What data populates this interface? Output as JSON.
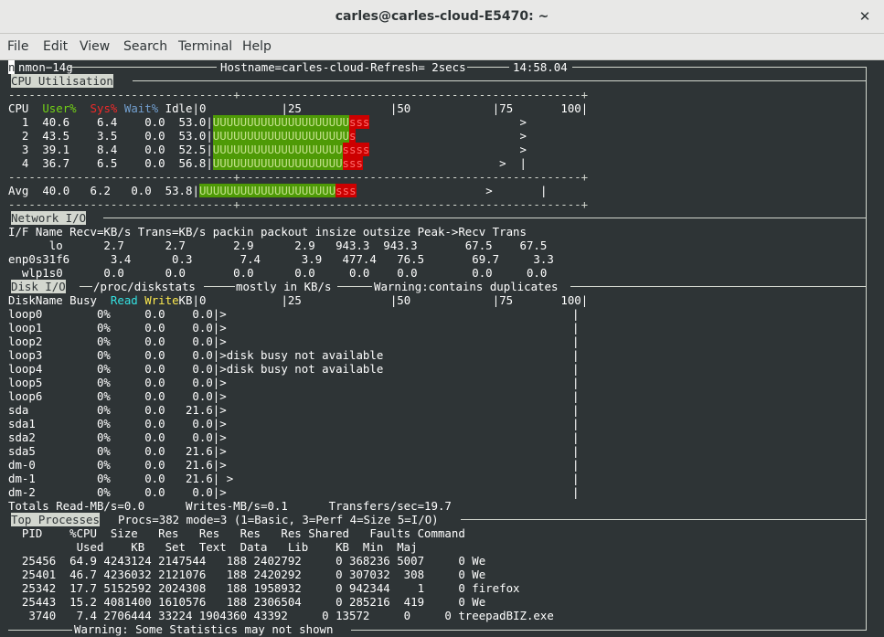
{
  "window": {
    "title": "carles@carles-cloud-E5470: ~"
  },
  "menu": [
    "File",
    "Edit",
    "View",
    "Search",
    "Terminal",
    "Help"
  ],
  "nmon": {
    "header_left": "nmon−14g",
    "header_center": "Hostname=carles-cloud-Refresh= 2secs",
    "header_time": "14:58.04",
    "cpu": {
      "title": "CPU Utilisation",
      "col_cpu": "CPU",
      "col_user": "User%",
      "col_sys": "Sys%",
      "col_wait": "Wait%",
      "col_idle": "Idle",
      "scale": [
        "0",
        "|25",
        "|50",
        "|75",
        "100"
      ],
      "rows": [
        {
          "id": "1",
          "user": "40.6",
          "sys": "6.4",
          "wait": "0.0",
          "idle": "53.0",
          "u_bar": "UUUUUUUUUUUUUUUUUUUU",
          "s_bar": "sss",
          "marker": ">"
        },
        {
          "id": "2",
          "user": "43.5",
          "sys": "3.5",
          "wait": "0.0",
          "idle": "53.0",
          "u_bar": "UUUUUUUUUUUUUUUUUUUU",
          "s_bar": "s",
          "marker": ">"
        },
        {
          "id": "3",
          "user": "39.1",
          "sys": "8.4",
          "wait": "0.0",
          "idle": "52.5",
          "u_bar": "UUUUUUUUUUUUUUUUUUU",
          "s_bar": "ssss",
          "marker": ">"
        },
        {
          "id": "4",
          "user": "36.7",
          "sys": "6.5",
          "wait": "0.0",
          "idle": "56.8",
          "u_bar": "UUUUUUUUUUUUUUUUUUU",
          "s_bar": "sss",
          "marker": ">"
        }
      ],
      "avg": {
        "label": "Avg",
        "user": "40.0",
        "sys": "6.2",
        "wait": "0.0",
        "idle": "53.8",
        "u_bar": "UUUUUUUUUUUUUUUUUUUU",
        "s_bar": "sss",
        "marker": ">"
      }
    },
    "network": {
      "title": "Network I/O",
      "header": "I/F Name Recv=KB/s Trans=KB/s packin packout insize outsize Peak->Recv Trans",
      "rows": [
        "      lo      2.7      2.7       2.9      2.9   943.3  943.3       67.5    67.5",
        "enp0s31f6      3.4      0.3       7.4      3.9   477.4   76.5       69.7     3.3",
        "  wlp1s0      0.0      0.0       0.0      0.0     0.0    0.0        0.0     0.0"
      ]
    },
    "disk": {
      "title": "Disk I/O",
      "source": "/proc/diskstats",
      "units_note": "mostly in KB/s",
      "warning": "Warning:contains duplicates",
      "col_name": "DiskName",
      "col_busy": "Busy",
      "col_read": "Read",
      "col_write": "Write",
      "col_kb": "KB",
      "rows": [
        {
          "name": "loop0",
          "busy": "0%",
          "read": "0.0",
          "write": "0.0",
          "note": ">"
        },
        {
          "name": "loop1",
          "busy": "0%",
          "read": "0.0",
          "write": "0.0",
          "note": ">"
        },
        {
          "name": "loop2",
          "busy": "0%",
          "read": "0.0",
          "write": "0.0",
          "note": ">"
        },
        {
          "name": "loop3",
          "busy": "0%",
          "read": "0.0",
          "write": "0.0",
          "note": ">disk busy not available"
        },
        {
          "name": "loop4",
          "busy": "0%",
          "read": "0.0",
          "write": "0.0",
          "note": ">disk busy not available"
        },
        {
          "name": "loop5",
          "busy": "0%",
          "read": "0.0",
          "write": "0.0",
          "note": ">"
        },
        {
          "name": "loop6",
          "busy": "0%",
          "read": "0.0",
          "write": "0.0",
          "note": ">"
        },
        {
          "name": "sda",
          "busy": "0%",
          "read": "0.0",
          "write": "21.6",
          "note": ">"
        },
        {
          "name": "sda1",
          "busy": "0%",
          "read": "0.0",
          "write": "0.0",
          "note": ">"
        },
        {
          "name": "sda2",
          "busy": "0%",
          "read": "0.0",
          "write": "0.0",
          "note": ">"
        },
        {
          "name": "sda5",
          "busy": "0%",
          "read": "0.0",
          "write": "21.6",
          "note": ">"
        },
        {
          "name": "dm-0",
          "busy": "0%",
          "read": "0.0",
          "write": "21.6",
          "note": ">"
        },
        {
          "name": "dm-1",
          "busy": "0%",
          "read": "0.0",
          "write": "21.6",
          "note": " >"
        },
        {
          "name": "dm-2",
          "busy": "0%",
          "read": "0.0",
          "write": "0.0",
          "note": ">"
        }
      ],
      "totals": "Totals Read-MB/s=0.0      Writes-MB/s=0.1      Transfers/sec=19.7"
    },
    "top": {
      "title": "Top Processes",
      "summary": "Procs=382 mode=3 (1=Basic, 3=Perf 4=Size 5=I/O)",
      "header1": "  PID    %CPU  Size   Res   Res   Res   Res Shared   Faults Command",
      "header2": "          Used    KB   Set  Text  Data   Lib    KB  Min  Maj",
      "rows": [
        "  25456  64.9 4243124 2147544   188 2402792     0 368236 5007     0 We",
        "  25401  46.7 4236032 2121076   188 2420292     0 307032  308     0 We",
        "  25342  17.7 5152592 2024308   188 1958932     0 942344    1     0 firefox",
        "  25443  15.2 4081400 1610576   188 2306504     0 285216  419     0 We",
        "   3740   7.4 2706444 33224 1904360 43392     0 13572     0     0 treepadBIZ.exe"
      ],
      "footer_warning": "Warning: Some Statistics may not shown"
    }
  }
}
